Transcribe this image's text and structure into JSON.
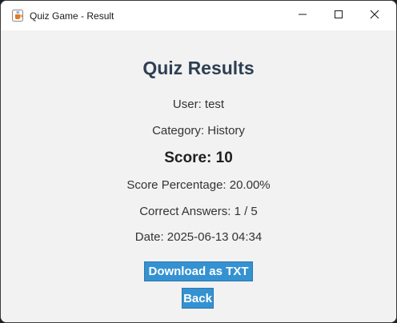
{
  "window": {
    "title": "Quiz Game - Result",
    "icon": "java-cup-icon"
  },
  "titlebar_controls": {
    "minimize_icon": "minimize-icon",
    "maximize_icon": "maximize-icon",
    "close_icon": "close-icon"
  },
  "result": {
    "heading": "Quiz Results",
    "user": "User: test",
    "category": "Category: History",
    "score": "Score: 10",
    "percentage": "Score Percentage: 20.00%",
    "correct": "Correct Answers: 1 / 5",
    "date": "Date: 2025-06-13 04:34"
  },
  "buttons": {
    "download_label": "Download as TXT",
    "back_label": "Back"
  },
  "colors": {
    "heading": "#2f3f52",
    "button_bg": "#3592d2",
    "button_text": "#ffffff",
    "content_bg": "#f2f2f2"
  }
}
